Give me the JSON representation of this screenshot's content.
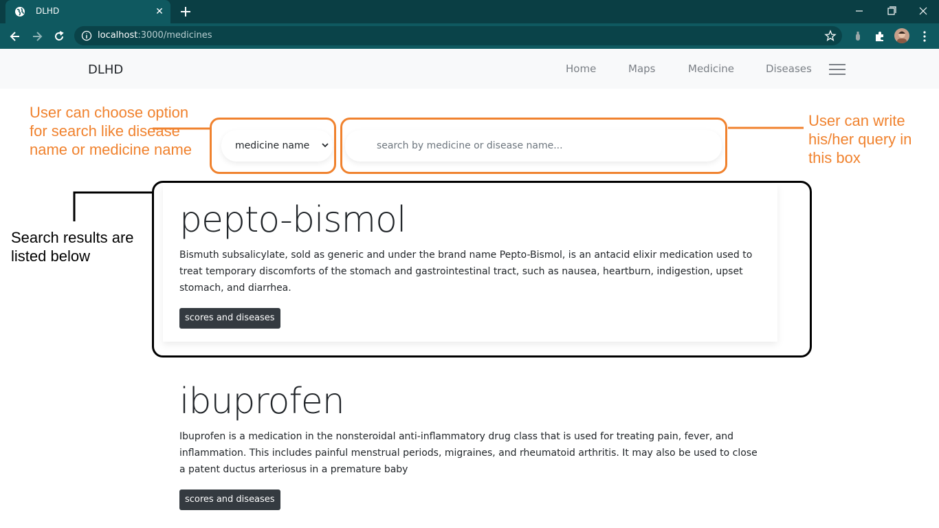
{
  "browser": {
    "tab_title": "DLHD",
    "url_host": "localhost",
    "url_path": ":3000/medicines"
  },
  "nav": {
    "brand": "DLHD",
    "links": [
      "Home",
      "Maps",
      "Medicine",
      "Diseases"
    ]
  },
  "search": {
    "select_value": "medicine name",
    "placeholder": "search by medicine or disease name..."
  },
  "results": [
    {
      "title": "pepto-bismol",
      "description": "Bismuth subsalicylate, sold as generic and under the brand name Pepto-Bismol, is an antacid elixir medication used to treat temporary discomforts of the stomach and gastrointestinal tract, such as nausea, heartburn, indigestion, upset stomach, and diarrhea.",
      "button": "scores and diseases"
    },
    {
      "title": "ibuprofen",
      "description": "Ibuprofen is a medication in the nonsteroidal anti-inflammatory drug class that is used for treating pain, fever, and inflammation. This includes painful menstrual periods, migraines, and rheumatoid arthritis. It may also be used to close a patent ductus arteriosus in a premature baby",
      "button": "scores and diseases"
    }
  ],
  "annotations": {
    "select_note": "User can choose option for search like disease name or medicine name",
    "search_note": "User can write his/her query in this box",
    "results_note": "Search results are listed below"
  },
  "colors": {
    "annotation_orange": "#f0822e",
    "chrome_dark": "#0a3e44",
    "chrome_toolbar": "#0f5960",
    "button_dark": "#343a40"
  }
}
